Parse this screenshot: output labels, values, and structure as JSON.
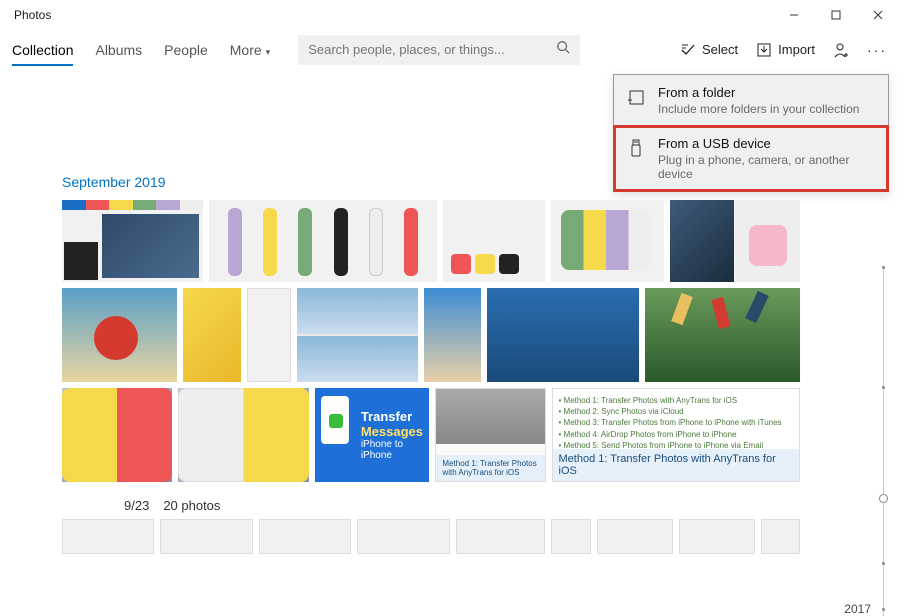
{
  "window": {
    "title": "Photos"
  },
  "tabs": {
    "collection": "Collection",
    "albums": "Albums",
    "people": "People",
    "more": "More"
  },
  "search": {
    "placeholder": "Search people, places, or things..."
  },
  "tools": {
    "select": "Select",
    "import": "Import"
  },
  "popup": {
    "folder": {
      "title": "From a folder",
      "sub": "Include more folders in your collection"
    },
    "usb": {
      "title": "From a USB device",
      "sub": "Plug in a phone, camera, or another device"
    }
  },
  "section": {
    "title": "September 2019"
  },
  "date_row": {
    "date": "9/23",
    "count": "20 photos"
  },
  "promo": {
    "line1": "Transfer",
    "line2": "Messages",
    "line3": "iPhone to iPhone"
  },
  "method_caption": "Method 1: Transfer Photos with AnyTrans for iOS",
  "doc_lines": {
    "l1": "• Method 1: Transfer Photos with AnyTrans for iOS",
    "l2": "• Method 2: Sync Photos via iCloud",
    "l3": "• Method 3: Transfer Photos from iPhone to iPhone with iTunes",
    "l4": "• Method 4: AirDrop Photos from iPhone to iPhone",
    "l5": "• Method 5: Send Photos from iPhone to iPhone via Email"
  },
  "timeline": {
    "year": "2017"
  }
}
